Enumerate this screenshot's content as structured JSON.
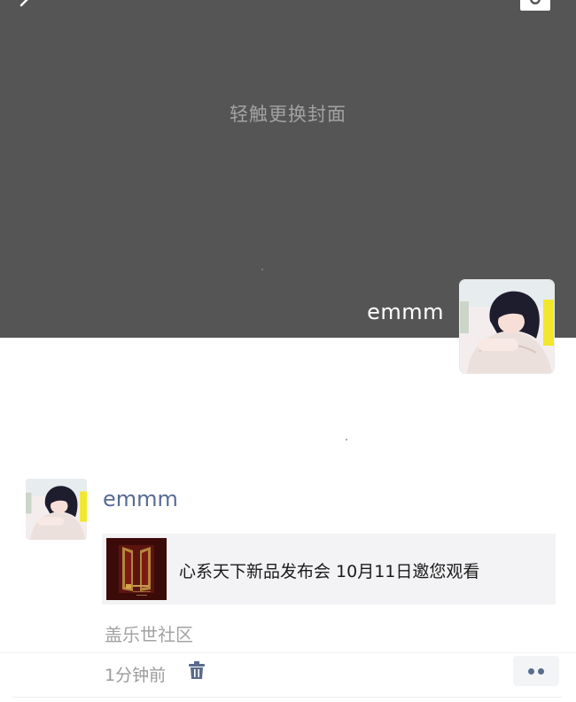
{
  "cover": {
    "hint": "轻触更换封面"
  },
  "profile": {
    "name": "emmm"
  },
  "post": {
    "author": "emmm",
    "share": {
      "title": "心系天下新品发布会 10月11日邀您观看"
    },
    "source": "盖乐世社区",
    "time": "1分钟前"
  },
  "icons": {
    "back": "chevron-left-icon",
    "camera": "camera-icon",
    "delete": "trash-icon",
    "more": "more-dots-icon"
  },
  "colors": {
    "cover_bg": "#555555",
    "link": "#576b95",
    "more_dots": "#5a6b8c"
  }
}
